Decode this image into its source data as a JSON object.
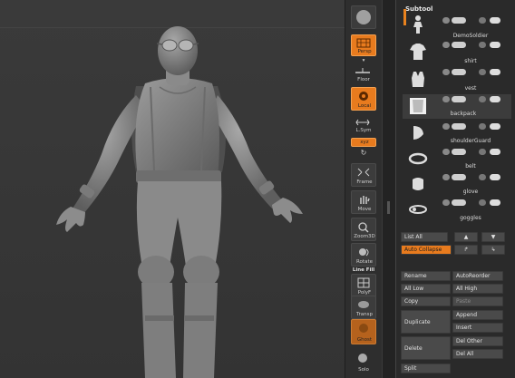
{
  "subtool_panel": {
    "title": "Subtool",
    "items": [
      {
        "name": "DemoSoldier",
        "icon": "soldier-thumbnail-icon"
      },
      {
        "name": "shirt",
        "icon": "shirt-thumbnail-icon"
      },
      {
        "name": "vest",
        "icon": "vest-thumbnail-icon"
      },
      {
        "name": "backpack",
        "icon": "backpack-thumbnail-icon"
      },
      {
        "name": "shoulderGuard",
        "icon": "shoulderguard-thumbnail-icon"
      },
      {
        "name": "belt",
        "icon": "belt-thumbnail-icon"
      },
      {
        "name": "glove",
        "icon": "glove-thumbnail-icon"
      },
      {
        "name": "goggles",
        "icon": "goggles-thumbnail-icon"
      }
    ],
    "list_all": "List All",
    "auto_collapse": "Auto Collapse",
    "actions": {
      "rename": "Rename",
      "auto_reorder": "AutoReorder",
      "all_low": "All Low",
      "all_high": "All High",
      "copy": "Copy",
      "paste": "Paste",
      "duplicate": "Duplicate",
      "append": "Append",
      "insert": "Insert",
      "delete": "Delete",
      "del_other": "Del Other",
      "del_all": "Del All",
      "split": "Split"
    }
  },
  "shelf": {
    "persp": "Persp",
    "floor": "Floor",
    "local": "Local",
    "lsym": "L.Sym",
    "xyz": "xyz",
    "frame": "Frame",
    "move": "Move",
    "zoom3d": "Zoom3D",
    "rotate": "Rotate",
    "linefill": "Line Fill",
    "polyf": "PolyF",
    "transp": "Transp",
    "ghost": "Ghost",
    "solo": "Solo"
  },
  "colors": {
    "accent": "#e87b1e",
    "panel": "#2a2a2a",
    "button": "#4a4a4a",
    "viewport": "#383838"
  }
}
